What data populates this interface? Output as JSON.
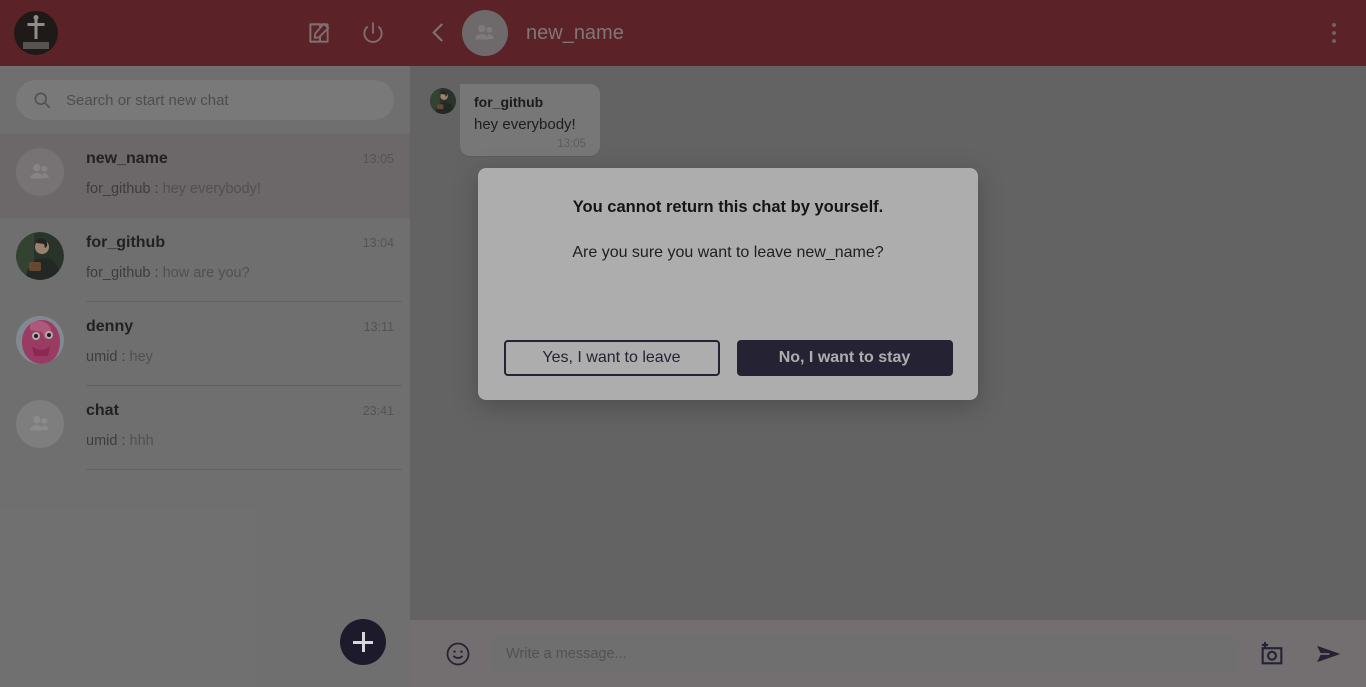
{
  "sidebar": {
    "profile": {
      "name": "profile-avatar"
    },
    "actions": [
      {
        "name": "compose-icon",
        "label": "New chat"
      },
      {
        "name": "power-icon",
        "label": "Log out"
      }
    ],
    "search": {
      "placeholder": "Search or start new chat",
      "value": ""
    },
    "fab": {
      "label": "+"
    },
    "chats": [
      {
        "name": "new_name",
        "time": "13:05",
        "sender": "for_github",
        "message": "hey everybody!",
        "avatar": "group",
        "active": true
      },
      {
        "name": "for_github",
        "time": "13:04",
        "sender": "for_github",
        "message": "how are you?",
        "avatar": "photo-man",
        "active": false
      },
      {
        "name": "denny",
        "time": "13:11",
        "sender": "umid",
        "message": "hey",
        "avatar": "photo-pink",
        "active": false
      },
      {
        "name": "chat",
        "time": "23:41",
        "sender": "umid",
        "message": "hhh",
        "avatar": "group",
        "active": false
      }
    ]
  },
  "chat": {
    "header": {
      "title": "new_name",
      "back": "back-chevron",
      "menu": "kebab-menu"
    },
    "messages": [
      {
        "author": "for_github",
        "text": "hey everybody!",
        "time": "13:05"
      }
    ],
    "composer": {
      "placeholder": "Write a message...",
      "value": "",
      "emoji": "emoji-icon",
      "camera": "camera-icon",
      "send": "send-icon"
    }
  },
  "modal": {
    "title": "You cannot return this chat by yourself.",
    "subtitle": "Are you sure you want to leave new_name?",
    "confirm_label": "Yes, I want to leave",
    "cancel_label": "No, I want to stay"
  },
  "colors": {
    "brand": "#7b2029",
    "sidebar_bg": "#9c9c9c",
    "main_bg": "#888888",
    "accent_dark": "#23203a",
    "bubble": "#a8a8a8",
    "composer_bg": "#a2999b"
  }
}
